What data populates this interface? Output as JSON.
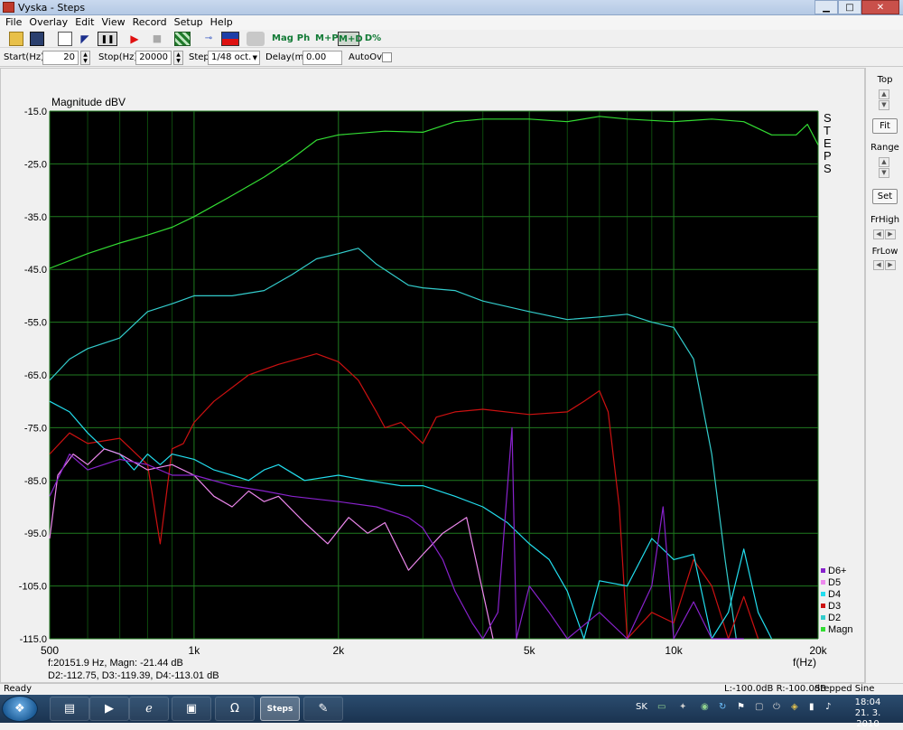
{
  "window": {
    "title": "Vyska - Steps",
    "minimize": "▁",
    "maximize": "□",
    "close": "✕"
  },
  "menu": [
    "File",
    "Overlay",
    "Edit",
    "View",
    "Record",
    "Setup",
    "Help"
  ],
  "toolbar": {
    "mag_label": "Mag",
    "ph_label": "Ph",
    "mp_label": "M+P",
    "md_label": "M+D",
    "dpct_label": "D%"
  },
  "params": {
    "start_label": "Start(Hz)",
    "start_value": "20",
    "stop_label": "Stop(Hz)",
    "stop_value": "20000",
    "step_label": "Step",
    "step_value": "1/48 oct.",
    "delay_label": "Delay(ms)",
    "delay_value": "0.00",
    "autoovr_label": "AutoOvr"
  },
  "plot": {
    "ylabel": "Magnitude dBV",
    "xlabel": "f(Hz)",
    "mode_letters": "STEPS",
    "readout_line1": "f:20151.9 Hz, Magn: -21.44 dB",
    "readout_line2": "D2:-112.75, D3:-119.39, D4:-113.01 dB"
  },
  "chart_data": {
    "type": "line",
    "xscale": "log",
    "xlim": [
      500,
      20000
    ],
    "ylim": [
      -115,
      -15
    ],
    "grid": true,
    "legend": "bottom-right",
    "xticks": [
      500,
      1000,
      2000,
      5000,
      10000,
      20000
    ],
    "xtick_labels": [
      "500",
      "1k",
      "2k",
      "5k",
      "10k",
      "20k"
    ],
    "yticks": [
      -15,
      -25,
      -35,
      -45,
      -55,
      -65,
      -75,
      -85,
      -95,
      -105,
      -115
    ],
    "ytick_labels": [
      "-15.0",
      "-25.0",
      "-35.0",
      "-45.0",
      "-55.0",
      "-65.0",
      "-75.0",
      "-85.0",
      "-95.0",
      "-105.0",
      "-115.0"
    ],
    "series": [
      {
        "name": "Magn",
        "color": "#33dd33",
        "points": [
          [
            500,
            -44.8
          ],
          [
            600,
            -42
          ],
          [
            700,
            -40
          ],
          [
            800,
            -38.5
          ],
          [
            900,
            -37
          ],
          [
            1000,
            -35
          ],
          [
            1200,
            -31
          ],
          [
            1400,
            -27.5
          ],
          [
            1600,
            -24
          ],
          [
            1800,
            -20.5
          ],
          [
            2000,
            -19.5
          ],
          [
            2500,
            -18.8
          ],
          [
            3000,
            -19
          ],
          [
            3500,
            -17
          ],
          [
            4000,
            -16.5
          ],
          [
            5000,
            -16.5
          ],
          [
            6000,
            -17
          ],
          [
            7000,
            -16
          ],
          [
            8000,
            -16.5
          ],
          [
            10000,
            -17
          ],
          [
            12000,
            -16.5
          ],
          [
            14000,
            -17
          ],
          [
            16000,
            -19.5
          ],
          [
            18000,
            -19.5
          ],
          [
            19000,
            -17.5
          ],
          [
            20000,
            -21.4
          ]
        ]
      },
      {
        "name": "D2",
        "color": "#33cccc",
        "points": [
          [
            500,
            -66
          ],
          [
            550,
            -62
          ],
          [
            600,
            -60
          ],
          [
            700,
            -58
          ],
          [
            800,
            -53
          ],
          [
            900,
            -51.5
          ],
          [
            1000,
            -50
          ],
          [
            1200,
            -50
          ],
          [
            1400,
            -49
          ],
          [
            1600,
            -46
          ],
          [
            1800,
            -43
          ],
          [
            2000,
            -42
          ],
          [
            2200,
            -41
          ],
          [
            2400,
            -44
          ],
          [
            2800,
            -48
          ],
          [
            3000,
            -48.5
          ],
          [
            3500,
            -49
          ],
          [
            4000,
            -51
          ],
          [
            5000,
            -53
          ],
          [
            6000,
            -54.5
          ],
          [
            7000,
            -54
          ],
          [
            8000,
            -53.5
          ],
          [
            9000,
            -55
          ],
          [
            10000,
            -56
          ],
          [
            11000,
            -62
          ],
          [
            12000,
            -80
          ],
          [
            12800,
            -100
          ],
          [
            13500,
            -115
          ]
        ]
      },
      {
        "name": "D3",
        "color": "#cc1111",
        "points": [
          [
            500,
            -80
          ],
          [
            550,
            -76
          ],
          [
            600,
            -78
          ],
          [
            700,
            -77
          ],
          [
            800,
            -82
          ],
          [
            850,
            -97
          ],
          [
            900,
            -79
          ],
          [
            950,
            -78
          ],
          [
            1000,
            -74
          ],
          [
            1100,
            -70
          ],
          [
            1300,
            -65
          ],
          [
            1500,
            -63
          ],
          [
            1800,
            -61
          ],
          [
            2000,
            -62.5
          ],
          [
            2200,
            -66
          ],
          [
            2400,
            -72
          ],
          [
            2500,
            -75
          ],
          [
            2700,
            -74
          ],
          [
            3000,
            -78
          ],
          [
            3200,
            -73
          ],
          [
            3500,
            -72
          ],
          [
            4000,
            -71.5
          ],
          [
            5000,
            -72.5
          ],
          [
            6000,
            -72
          ],
          [
            6500,
            -70
          ],
          [
            7000,
            -68
          ],
          [
            7300,
            -72
          ],
          [
            7700,
            -90
          ],
          [
            8000,
            -115
          ],
          [
            9000,
            -110
          ],
          [
            10000,
            -112
          ],
          [
            11000,
            -100
          ],
          [
            12000,
            -105
          ],
          [
            13000,
            -115
          ],
          [
            14000,
            -107
          ],
          [
            15000,
            -115
          ]
        ]
      },
      {
        "name": "D4",
        "color": "#22ddee",
        "points": [
          [
            500,
            -70
          ],
          [
            550,
            -72
          ],
          [
            600,
            -76
          ],
          [
            650,
            -79
          ],
          [
            700,
            -80
          ],
          [
            750,
            -83
          ],
          [
            800,
            -80
          ],
          [
            850,
            -82
          ],
          [
            900,
            -80
          ],
          [
            1000,
            -81
          ],
          [
            1100,
            -83
          ],
          [
            1200,
            -84
          ],
          [
            1300,
            -85
          ],
          [
            1400,
            -83
          ],
          [
            1500,
            -82
          ],
          [
            1700,
            -85
          ],
          [
            2000,
            -84
          ],
          [
            2300,
            -85
          ],
          [
            2700,
            -86
          ],
          [
            3000,
            -86
          ],
          [
            3500,
            -88
          ],
          [
            4000,
            -90
          ],
          [
            4500,
            -93
          ],
          [
            5000,
            -97
          ],
          [
            5500,
            -100
          ],
          [
            6000,
            -106
          ],
          [
            6500,
            -115
          ],
          [
            7000,
            -104
          ],
          [
            8000,
            -105
          ],
          [
            9000,
            -96
          ],
          [
            10000,
            -100
          ],
          [
            11000,
            -99
          ],
          [
            12000,
            -115
          ],
          [
            13000,
            -110
          ],
          [
            14000,
            -98
          ],
          [
            15000,
            -110
          ],
          [
            16000,
            -115
          ]
        ]
      },
      {
        "name": "D5",
        "color": "#ee88ee",
        "points": [
          [
            500,
            -96
          ],
          [
            520,
            -84
          ],
          [
            560,
            -80
          ],
          [
            600,
            -82
          ],
          [
            650,
            -79
          ],
          [
            700,
            -80
          ],
          [
            800,
            -83
          ],
          [
            900,
            -82
          ],
          [
            1000,
            -84
          ],
          [
            1100,
            -88
          ],
          [
            1200,
            -90
          ],
          [
            1300,
            -87
          ],
          [
            1400,
            -89
          ],
          [
            1500,
            -88
          ],
          [
            1700,
            -93
          ],
          [
            1900,
            -97
          ],
          [
            2100,
            -92
          ],
          [
            2300,
            -95
          ],
          [
            2500,
            -93
          ],
          [
            2800,
            -102
          ],
          [
            3000,
            -99
          ],
          [
            3300,
            -95
          ],
          [
            3700,
            -92
          ],
          [
            4200,
            -115
          ]
        ]
      },
      {
        "name": "D6+",
        "color": "#8822cc",
        "points": [
          [
            500,
            -88
          ],
          [
            550,
            -80
          ],
          [
            600,
            -83
          ],
          [
            700,
            -81
          ],
          [
            800,
            -82
          ],
          [
            900,
            -84
          ],
          [
            1000,
            -84
          ],
          [
            1200,
            -86
          ],
          [
            1400,
            -87
          ],
          [
            1600,
            -88
          ],
          [
            2000,
            -89
          ],
          [
            2400,
            -90
          ],
          [
            2800,
            -92
          ],
          [
            3000,
            -94
          ],
          [
            3300,
            -100
          ],
          [
            3500,
            -106
          ],
          [
            3800,
            -112
          ],
          [
            4000,
            -115
          ],
          [
            4300,
            -110
          ],
          [
            4600,
            -75
          ],
          [
            4700,
            -115
          ],
          [
            5000,
            -105
          ],
          [
            5500,
            -110
          ],
          [
            6000,
            -115
          ],
          [
            7000,
            -110
          ],
          [
            8000,
            -115
          ],
          [
            9000,
            -105
          ],
          [
            9500,
            -90
          ],
          [
            10000,
            -115
          ],
          [
            11000,
            -108
          ],
          [
            12000,
            -115
          ],
          [
            14000,
            -115
          ]
        ]
      }
    ]
  },
  "right_panel": {
    "top_label": "Top",
    "fit_label": "Fit",
    "range_label": "Range",
    "set_label": "Set",
    "frhigh_label": "FrHigh",
    "frlow_label": "FrLow"
  },
  "status": {
    "left": "Ready",
    "levels": "L:-100.0dB  R:-100.0dB",
    "mode": "Stepped Sine Response"
  },
  "taskbar": {
    "steps_label": "Steps",
    "lang": "SK",
    "time": "18:04",
    "date": "21. 3. 2010"
  }
}
